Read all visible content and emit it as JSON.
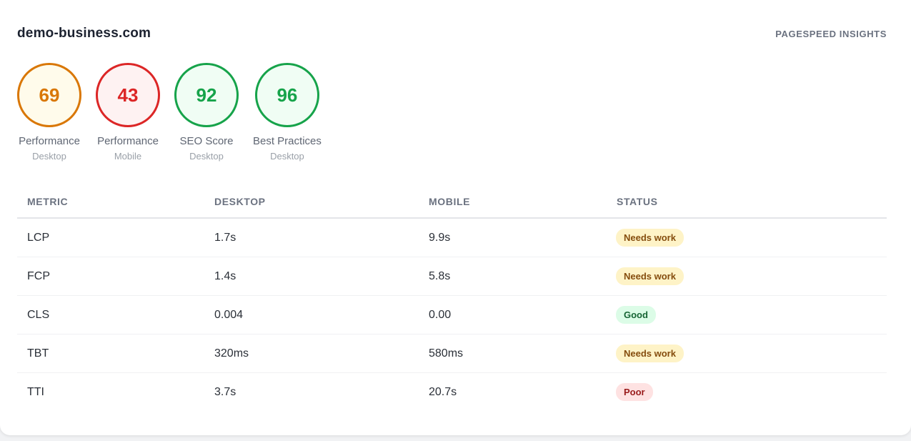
{
  "header": {
    "site": "demo-business.com",
    "provider": "PAGESPEED INSIGHTS"
  },
  "scores": [
    {
      "value": "69",
      "label": "Performance",
      "sub": "Desktop",
      "ring_color": "#d97706",
      "fill_color": "#fffbeb",
      "text_color": "#d97706"
    },
    {
      "value": "43",
      "label": "Performance",
      "sub": "Mobile",
      "ring_color": "#dc2626",
      "fill_color": "#fef2f2",
      "text_color": "#dc2626"
    },
    {
      "value": "92",
      "label": "SEO Score",
      "sub": "Desktop",
      "ring_color": "#16a34a",
      "fill_color": "#f0fdf4",
      "text_color": "#16a34a"
    },
    {
      "value": "96",
      "label": "Best Practices",
      "sub": "Desktop",
      "ring_color": "#16a34a",
      "fill_color": "#f0fdf4",
      "text_color": "#16a34a"
    }
  ],
  "table": {
    "headers": [
      "METRIC",
      "DESKTOP",
      "MOBILE",
      "STATUS"
    ],
    "rows": [
      {
        "metric": "LCP",
        "desktop": "1.7s",
        "mobile": "9.9s",
        "status": "Needs work",
        "status_bg": "#fef3c7",
        "status_fg": "#854d0e"
      },
      {
        "metric": "FCP",
        "desktop": "1.4s",
        "mobile": "5.8s",
        "status": "Needs work",
        "status_bg": "#fef3c7",
        "status_fg": "#854d0e"
      },
      {
        "metric": "CLS",
        "desktop": "0.004",
        "mobile": "0.00",
        "status": "Good",
        "status_bg": "#dcfce7",
        "status_fg": "#166534"
      },
      {
        "metric": "TBT",
        "desktop": "320ms",
        "mobile": "580ms",
        "status": "Needs work",
        "status_bg": "#fef3c7",
        "status_fg": "#854d0e"
      },
      {
        "metric": "TTI",
        "desktop": "3.7s",
        "mobile": "20.7s",
        "status": "Poor",
        "status_bg": "#fee2e2",
        "status_fg": "#991b1b"
      }
    ]
  }
}
